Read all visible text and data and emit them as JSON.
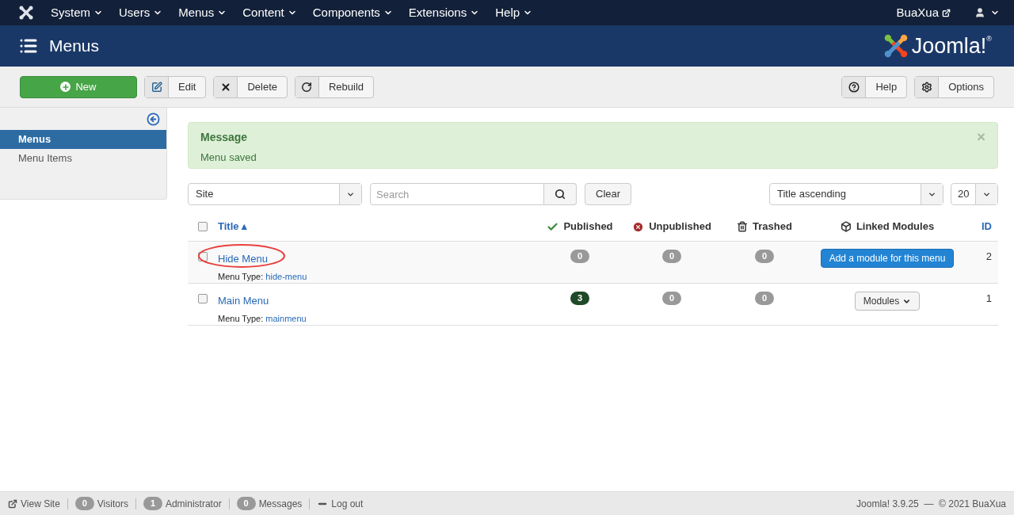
{
  "topnav": {
    "items": [
      "System",
      "Users",
      "Menus",
      "Content",
      "Components",
      "Extensions",
      "Help"
    ],
    "site_link": "BuaXua"
  },
  "header": {
    "title": "Menus",
    "logo_text": "Joomla!$^{®}$"
  },
  "toolbar": {
    "left": [
      {
        "kind": "primary",
        "label": "New"
      },
      {
        "kind": "default",
        "label": "Edit"
      },
      {
        "kind": "default",
        "label": "Delete"
      },
      {
        "kind": "default",
        "label": "Rebuild"
      }
    ],
    "right": [
      {
        "kind": "default",
        "label": "Help"
      },
      {
        "kind": "default",
        "label": "Options"
      }
    ]
  },
  "sidebar": {
    "items": [
      {
        "label": "Menus",
        "selected": true
      },
      {
        "label": "Menu Items",
        "selected": false
      }
    ]
  },
  "message": {
    "heading": "Message",
    "text": "Menu saved",
    "close": "×"
  },
  "filters": {
    "client": "Site",
    "search_placeholder": "Search",
    "clear": "Clear",
    "ordering": "Title ascending",
    "limit": "20"
  },
  "table": {
    "select_all_checked": false,
    "columns": [
      {
        "label": "Title ▴",
        "kind": "sort"
      },
      {
        "label": "Published",
        "kind": "published"
      },
      {
        "label": "Unpublished",
        "kind": "unpublished"
      },
      {
        "label": "Trashed",
        "kind": "trashed"
      },
      {
        "label": "Linked Modules",
        "kind": "modules"
      },
      {
        "label": "ID",
        "kind": "id"
      }
    ],
    "rows": [
      {
        "title": "Hide Menu",
        "circled": true,
        "type_label": "Menu Type:",
        "type_value": "hide-menu",
        "checked": false,
        "counts": [
          {
            "text": "0",
            "color": "#999999"
          },
          {
            "text": "0",
            "color": "#999999"
          },
          {
            "text": "0",
            "color": "#999999"
          }
        ],
        "modules": {
          "kind": "add",
          "label": "Add a module for this menu"
        },
        "id": "2"
      },
      {
        "title": "Main Menu",
        "circled": false,
        "type_label": "Menu Type:",
        "type_value": "mainmenu",
        "checked": false,
        "counts": [
          {
            "text": "3",
            "color": "#1e4a29"
          },
          {
            "text": "0",
            "color": "#999999"
          },
          {
            "text": "0",
            "color": "#999999"
          }
        ],
        "modules": {
          "kind": "dropdown",
          "label": "Modules"
        },
        "id": "1"
      }
    ]
  },
  "footer": {
    "left": [
      {
        "kind": "link",
        "label": "View Site"
      },
      {
        "kind": "count",
        "count": "0",
        "label": "Visitors"
      },
      {
        "kind": "count",
        "count": "1",
        "label": "Administrator"
      },
      {
        "kind": "count",
        "count": "0",
        "label": "Messages"
      },
      {
        "kind": "logout",
        "label": "Log out"
      }
    ],
    "right": "Joomla! 3.9.25  —  © 2021 BuaXua"
  }
}
